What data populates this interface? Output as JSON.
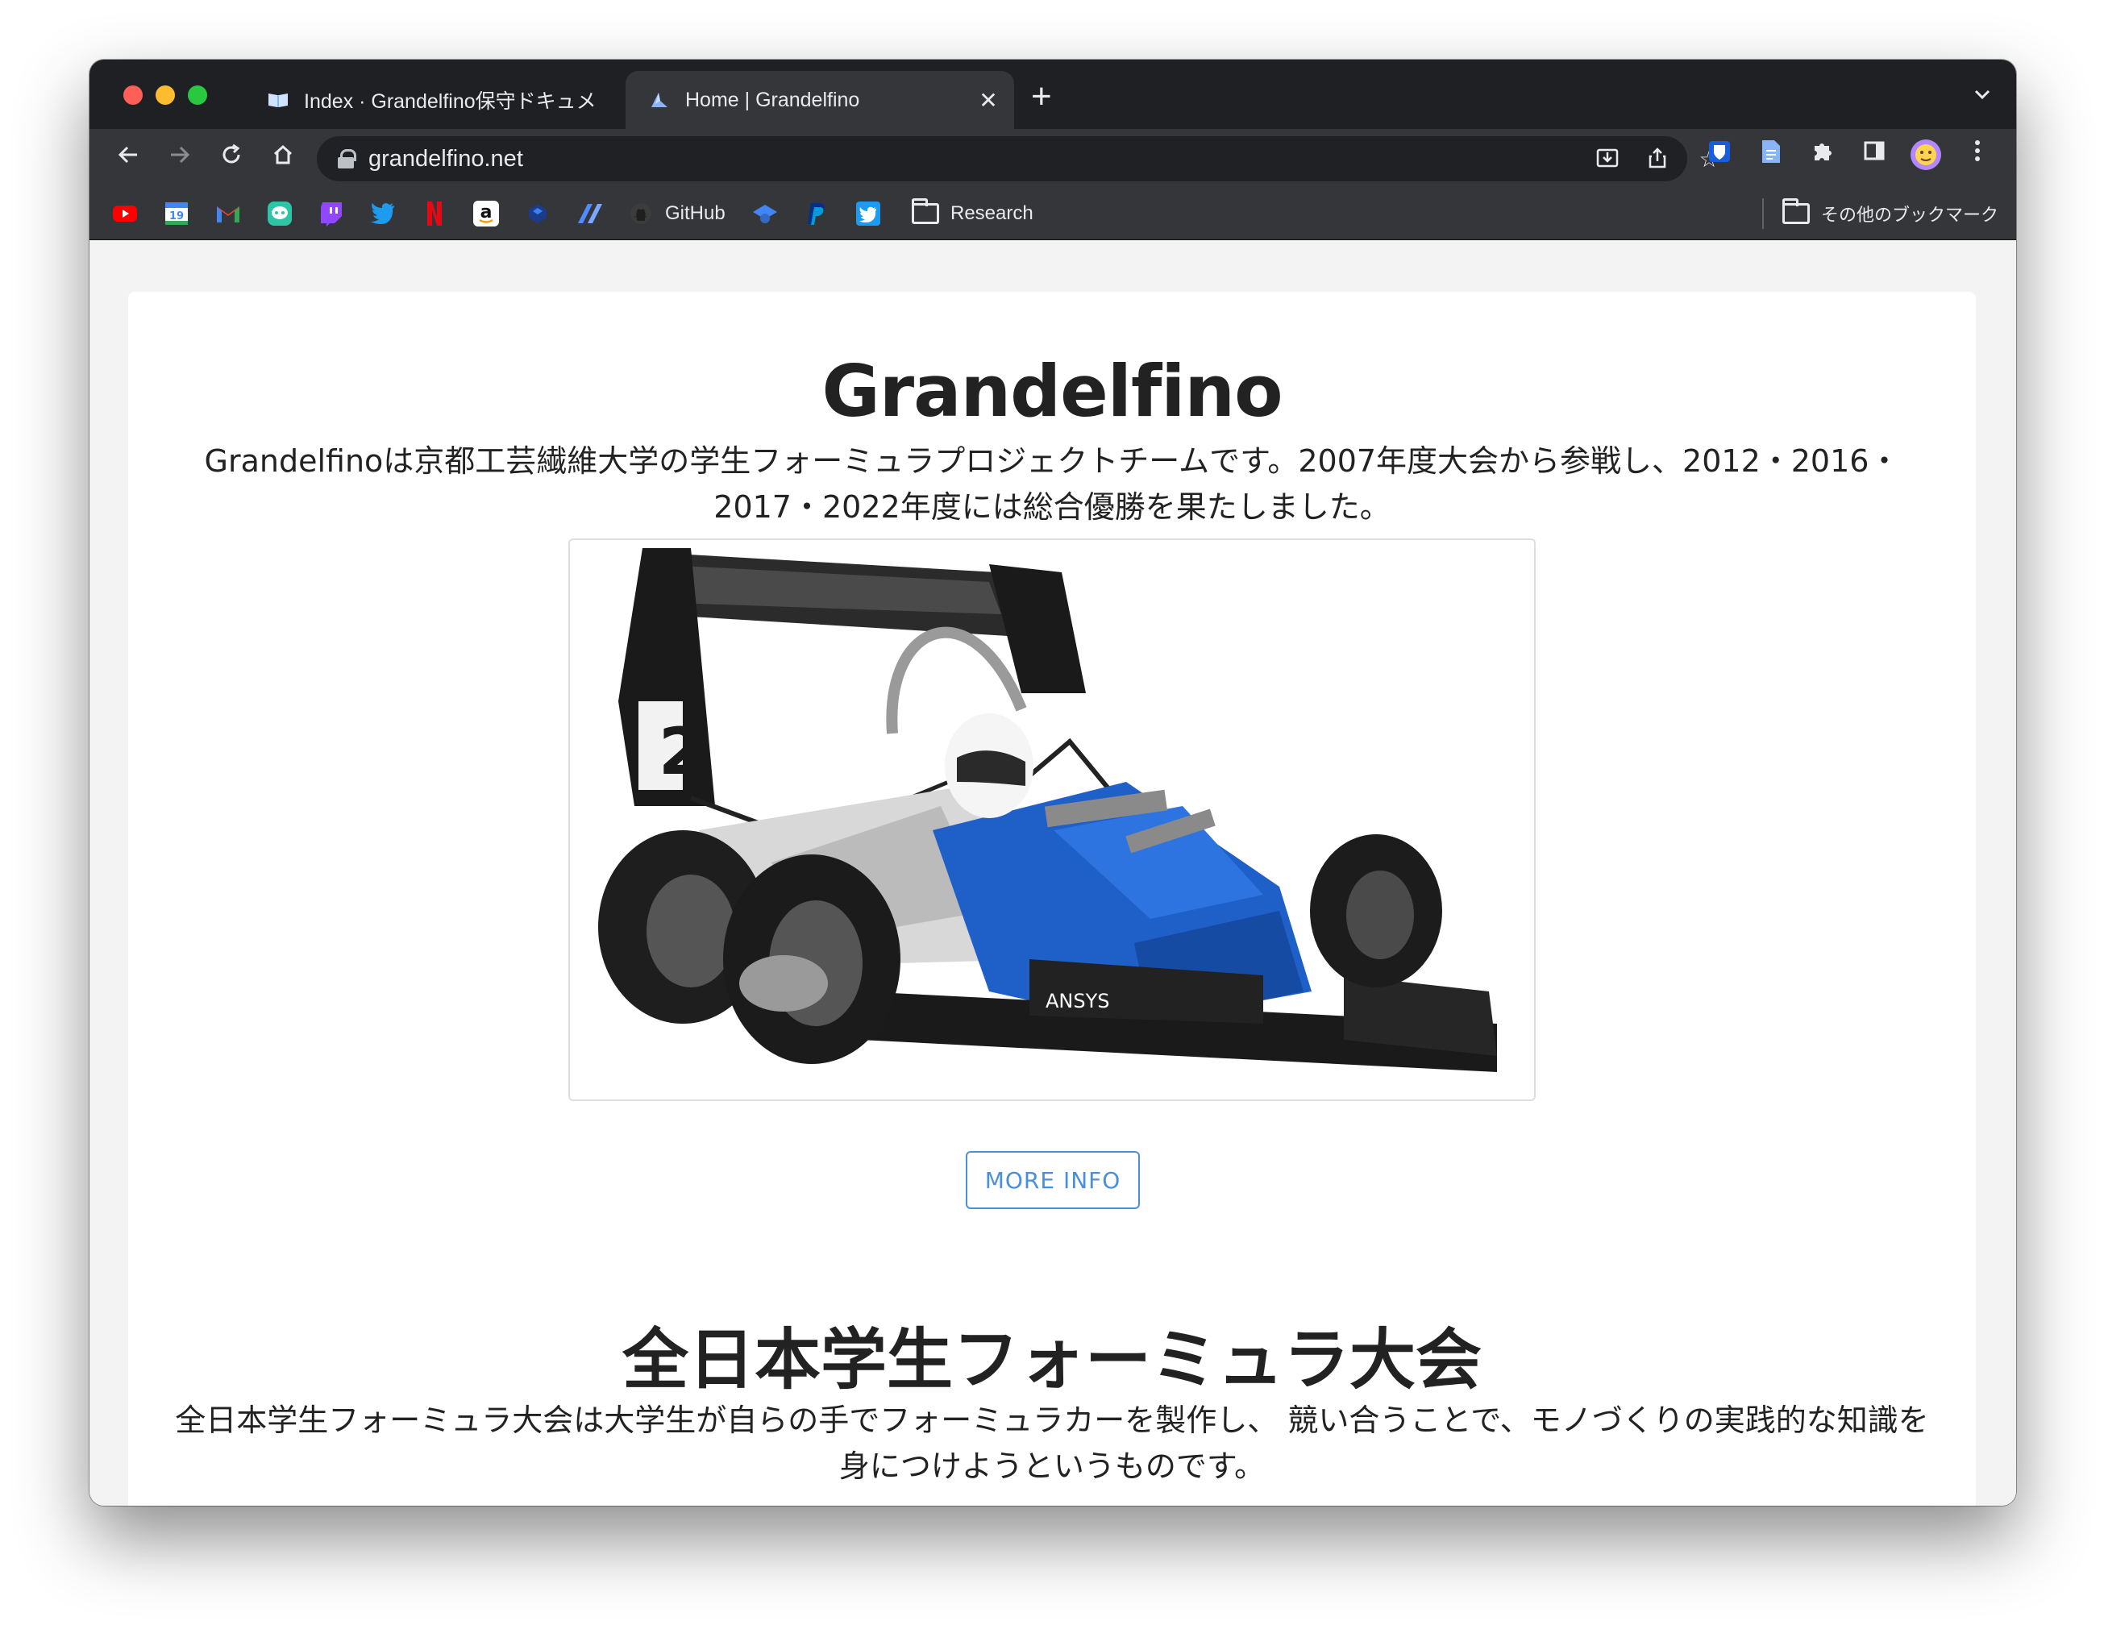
{
  "tabs": [
    {
      "title": "Index · Grandelfino保守ドキュメ",
      "icon": "book-icon",
      "active": false
    },
    {
      "title": "Home | Grandelfino",
      "icon": "site-logo-icon",
      "active": true
    }
  ],
  "toolbar": {
    "url": "grandelfino.net"
  },
  "bookmarks": {
    "items": [
      {
        "label": "",
        "icon": "youtube-icon",
        "color": "#ff0000"
      },
      {
        "label": "",
        "icon": "calendar-icon",
        "color": "#4285f4",
        "glyph": "19"
      },
      {
        "label": "",
        "icon": "gmail-icon",
        "color": "#ea4335",
        "glyph": "M"
      },
      {
        "label": "",
        "icon": "chat-icon",
        "color": "#34a853"
      },
      {
        "label": "",
        "icon": "twitch-icon",
        "color": "#9146ff"
      },
      {
        "label": "",
        "icon": "twitter-icon",
        "color": "#1d9bf0"
      },
      {
        "label": "",
        "icon": "netflix-icon",
        "color": "#e50914",
        "glyph": "N"
      },
      {
        "label": "",
        "icon": "amazon-icon",
        "color": "#ffffff",
        "glyph": "a"
      },
      {
        "label": "",
        "icon": "dropbox-icon",
        "color": "#0061ff"
      },
      {
        "label": "",
        "icon": "slash-icon",
        "color": "#4f8cff"
      },
      {
        "label": "GitHub",
        "icon": "github-icon",
        "color": "#e8eaed"
      },
      {
        "label": "",
        "icon": "graduation-icon",
        "color": "#4285f4"
      },
      {
        "label": "",
        "icon": "paypal-icon",
        "color": "#0070ba",
        "glyph": "P"
      },
      {
        "label": "",
        "icon": "twitter-square-icon",
        "color": "#1d9bf0"
      },
      {
        "label": "Research",
        "icon": "folder-icon",
        "color": "#e8eaed"
      }
    ],
    "other": "その他のブックマーク"
  },
  "page": {
    "title": "Grandelfino",
    "lead": "Grandelfinoは京都工芸繊維大学の学生フォーミュラプロジェクトチームです。2007年度大会から参戦し、2012・2016・2017・2022年度には総合優勝を果たしました。",
    "more_button": "MORE INFO",
    "section_title": "全日本学生フォーミュラ大会",
    "section_body": "全日本学生フォーミュラ大会は大学生が自らの手でフォーミュラカーを製作し、 競い合うことで、モノづくりの実践的な知識を身につけようというものです。"
  },
  "colors": {
    "accent": "#4a90d9",
    "chrome_dark": "#1f2023",
    "chrome_toolbar": "#35363a"
  }
}
